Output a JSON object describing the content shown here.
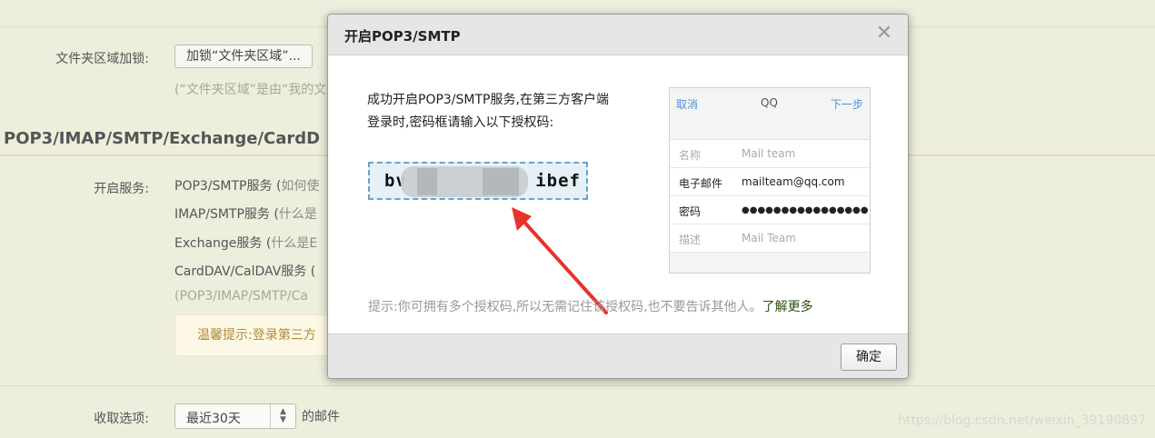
{
  "background": {
    "folder_lock_label": "文件夹区域加锁:",
    "folder_lock_button": "加锁“文件夹区域”...",
    "folder_note": "(“文件夹区域”是由“我的文",
    "section_title": "POP3/IMAP/SMTP/Exchange/CardD",
    "service_label": "开启服务:",
    "services": [
      {
        "name": "POP3/SMTP服务 (",
        "hint": "如何使"
      },
      {
        "name": "IMAP/SMTP服务 (",
        "hint": "什么是"
      },
      {
        "name": "Exchange服务 (",
        "hint": "什么是E"
      },
      {
        "name": "CardDAV/CalDAV服务 (",
        "hint": ""
      }
    ],
    "services_note": "(POP3/IMAP/SMTP/Ca",
    "warm_tip": "温馨提示:登录第三方",
    "fetch_label": "收取选项:",
    "fetch_select": "最近30天",
    "fetch_suffix": "的邮件",
    "watermark": "https://blog.csdn.net/weixin_39190897"
  },
  "dialog": {
    "title": "开启POP3/SMTP",
    "close_icon": "close-x",
    "message_line1": "成功开启POP3/SMTP服务,在第三方客户端",
    "message_line2": "登录时,密码框请输入以下授权码:",
    "code_prefix": "bv",
    "code_suffix": "ibef",
    "phone": {
      "cancel": "取消",
      "title": "QQ",
      "next": "下一步",
      "rows": [
        {
          "key": "名称",
          "value": "Mail team"
        },
        {
          "key": "电子邮件",
          "value": "mailteam@qq.com"
        },
        {
          "key": "密码",
          "value": "●●●●●●●●●●●●●●●●"
        },
        {
          "key": "描述",
          "value": "Mail Team"
        }
      ]
    },
    "tip": "提示:你可拥有多个授权码,所以无需记住该授权码,也不要告诉其他人。",
    "learn_more": "了解更多",
    "ok_button": "确定",
    "arrow_color": "#e8322c"
  }
}
